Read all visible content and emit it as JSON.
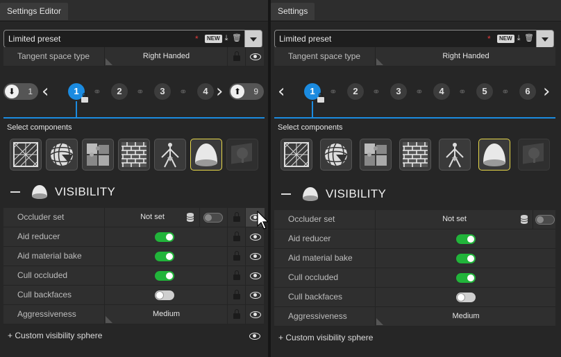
{
  "left_panel": {
    "tab_title": "Settings Editor",
    "preset_name": "Limited preset",
    "preset_modified_mark": "*",
    "new_badge": "NEW",
    "tangent": {
      "label": "Tangent space type",
      "value": "Right Handed"
    },
    "lod_start": "1",
    "lod_numbers": [
      "1",
      "2",
      "3",
      "4"
    ],
    "lod_end": "9",
    "select_components_label": "Select components",
    "section_title": "VISIBILITY",
    "rows": [
      {
        "label": "Occluder set",
        "type": "value",
        "value": "Not set"
      },
      {
        "label": "Aid reducer",
        "type": "toggle",
        "on": true
      },
      {
        "label": "Aid material bake",
        "type": "toggle",
        "on": true
      },
      {
        "label": "Cull occluded",
        "type": "toggle",
        "on": true
      },
      {
        "label": "Cull backfaces",
        "type": "toggle",
        "on": false
      },
      {
        "label": "Aggressiveness",
        "type": "value",
        "value": "Medium"
      }
    ],
    "custom_label": "+ Custom visibility sphere"
  },
  "right_panel": {
    "tab_title": "Settings",
    "preset_name": "Limited preset",
    "preset_modified_mark": "*",
    "new_badge": "NEW",
    "tangent": {
      "label": "Tangent space type",
      "value": "Right Handed"
    },
    "lod_numbers": [
      "1",
      "2",
      "3",
      "4",
      "5",
      "6"
    ],
    "select_components_label": "Select components",
    "section_title": "VISIBILITY",
    "rows": [
      {
        "label": "Occluder set",
        "type": "value",
        "value": "Not set"
      },
      {
        "label": "Aid reducer",
        "type": "toggle",
        "on": true
      },
      {
        "label": "Aid material bake",
        "type": "toggle",
        "on": true
      },
      {
        "label": "Cull occluded",
        "type": "toggle",
        "on": true
      },
      {
        "label": "Cull backfaces",
        "type": "toggle",
        "on": false
      },
      {
        "label": "Aggressiveness",
        "type": "value",
        "value": "Medium"
      }
    ],
    "custom_label": "+ Custom visibility sphere"
  },
  "components": [
    "wireframe-icon",
    "sphere-grid-icon",
    "puzzle-icon",
    "brick-icon",
    "skeleton-icon",
    "dome-icon",
    "disabled-tree-icon"
  ],
  "colors": {
    "accent": "#1b8be0",
    "toggle_on": "#21b43a",
    "selected_border": "#e8d84a",
    "modified": "#e23b3b"
  }
}
